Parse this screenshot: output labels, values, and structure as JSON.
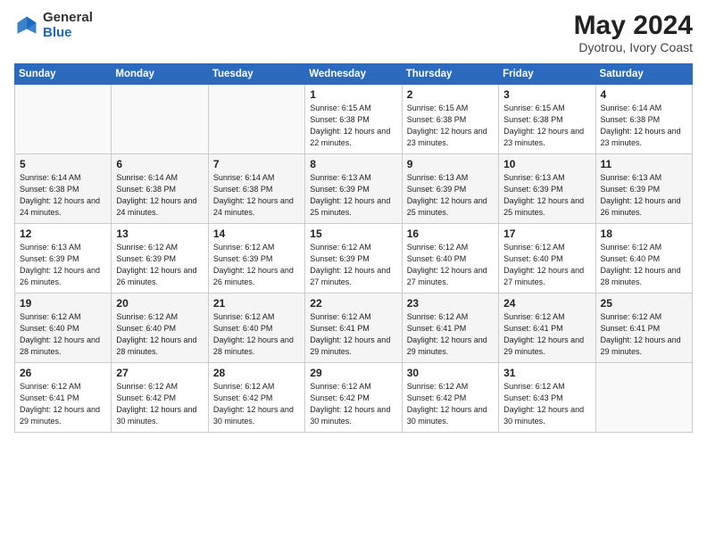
{
  "header": {
    "logo_general": "General",
    "logo_blue": "Blue",
    "month_title": "May 2024",
    "subtitle": "Dyotrou, Ivory Coast"
  },
  "weekdays": [
    "Sunday",
    "Monday",
    "Tuesday",
    "Wednesday",
    "Thursday",
    "Friday",
    "Saturday"
  ],
  "weeks": [
    [
      {
        "day": "",
        "sunrise": "",
        "sunset": "",
        "daylight": ""
      },
      {
        "day": "",
        "sunrise": "",
        "sunset": "",
        "daylight": ""
      },
      {
        "day": "",
        "sunrise": "",
        "sunset": "",
        "daylight": ""
      },
      {
        "day": "1",
        "sunrise": "Sunrise: 6:15 AM",
        "sunset": "Sunset: 6:38 PM",
        "daylight": "Daylight: 12 hours and 22 minutes."
      },
      {
        "day": "2",
        "sunrise": "Sunrise: 6:15 AM",
        "sunset": "Sunset: 6:38 PM",
        "daylight": "Daylight: 12 hours and 23 minutes."
      },
      {
        "day": "3",
        "sunrise": "Sunrise: 6:15 AM",
        "sunset": "Sunset: 6:38 PM",
        "daylight": "Daylight: 12 hours and 23 minutes."
      },
      {
        "day": "4",
        "sunrise": "Sunrise: 6:14 AM",
        "sunset": "Sunset: 6:38 PM",
        "daylight": "Daylight: 12 hours and 23 minutes."
      }
    ],
    [
      {
        "day": "5",
        "sunrise": "Sunrise: 6:14 AM",
        "sunset": "Sunset: 6:38 PM",
        "daylight": "Daylight: 12 hours and 24 minutes."
      },
      {
        "day": "6",
        "sunrise": "Sunrise: 6:14 AM",
        "sunset": "Sunset: 6:38 PM",
        "daylight": "Daylight: 12 hours and 24 minutes."
      },
      {
        "day": "7",
        "sunrise": "Sunrise: 6:14 AM",
        "sunset": "Sunset: 6:38 PM",
        "daylight": "Daylight: 12 hours and 24 minutes."
      },
      {
        "day": "8",
        "sunrise": "Sunrise: 6:13 AM",
        "sunset": "Sunset: 6:39 PM",
        "daylight": "Daylight: 12 hours and 25 minutes."
      },
      {
        "day": "9",
        "sunrise": "Sunrise: 6:13 AM",
        "sunset": "Sunset: 6:39 PM",
        "daylight": "Daylight: 12 hours and 25 minutes."
      },
      {
        "day": "10",
        "sunrise": "Sunrise: 6:13 AM",
        "sunset": "Sunset: 6:39 PM",
        "daylight": "Daylight: 12 hours and 25 minutes."
      },
      {
        "day": "11",
        "sunrise": "Sunrise: 6:13 AM",
        "sunset": "Sunset: 6:39 PM",
        "daylight": "Daylight: 12 hours and 26 minutes."
      }
    ],
    [
      {
        "day": "12",
        "sunrise": "Sunrise: 6:13 AM",
        "sunset": "Sunset: 6:39 PM",
        "daylight": "Daylight: 12 hours and 26 minutes."
      },
      {
        "day": "13",
        "sunrise": "Sunrise: 6:12 AM",
        "sunset": "Sunset: 6:39 PM",
        "daylight": "Daylight: 12 hours and 26 minutes."
      },
      {
        "day": "14",
        "sunrise": "Sunrise: 6:12 AM",
        "sunset": "Sunset: 6:39 PM",
        "daylight": "Daylight: 12 hours and 26 minutes."
      },
      {
        "day": "15",
        "sunrise": "Sunrise: 6:12 AM",
        "sunset": "Sunset: 6:39 PM",
        "daylight": "Daylight: 12 hours and 27 minutes."
      },
      {
        "day": "16",
        "sunrise": "Sunrise: 6:12 AM",
        "sunset": "Sunset: 6:40 PM",
        "daylight": "Daylight: 12 hours and 27 minutes."
      },
      {
        "day": "17",
        "sunrise": "Sunrise: 6:12 AM",
        "sunset": "Sunset: 6:40 PM",
        "daylight": "Daylight: 12 hours and 27 minutes."
      },
      {
        "day": "18",
        "sunrise": "Sunrise: 6:12 AM",
        "sunset": "Sunset: 6:40 PM",
        "daylight": "Daylight: 12 hours and 28 minutes."
      }
    ],
    [
      {
        "day": "19",
        "sunrise": "Sunrise: 6:12 AM",
        "sunset": "Sunset: 6:40 PM",
        "daylight": "Daylight: 12 hours and 28 minutes."
      },
      {
        "day": "20",
        "sunrise": "Sunrise: 6:12 AM",
        "sunset": "Sunset: 6:40 PM",
        "daylight": "Daylight: 12 hours and 28 minutes."
      },
      {
        "day": "21",
        "sunrise": "Sunrise: 6:12 AM",
        "sunset": "Sunset: 6:40 PM",
        "daylight": "Daylight: 12 hours and 28 minutes."
      },
      {
        "day": "22",
        "sunrise": "Sunrise: 6:12 AM",
        "sunset": "Sunset: 6:41 PM",
        "daylight": "Daylight: 12 hours and 29 minutes."
      },
      {
        "day": "23",
        "sunrise": "Sunrise: 6:12 AM",
        "sunset": "Sunset: 6:41 PM",
        "daylight": "Daylight: 12 hours and 29 minutes."
      },
      {
        "day": "24",
        "sunrise": "Sunrise: 6:12 AM",
        "sunset": "Sunset: 6:41 PM",
        "daylight": "Daylight: 12 hours and 29 minutes."
      },
      {
        "day": "25",
        "sunrise": "Sunrise: 6:12 AM",
        "sunset": "Sunset: 6:41 PM",
        "daylight": "Daylight: 12 hours and 29 minutes."
      }
    ],
    [
      {
        "day": "26",
        "sunrise": "Sunrise: 6:12 AM",
        "sunset": "Sunset: 6:41 PM",
        "daylight": "Daylight: 12 hours and 29 minutes."
      },
      {
        "day": "27",
        "sunrise": "Sunrise: 6:12 AM",
        "sunset": "Sunset: 6:42 PM",
        "daylight": "Daylight: 12 hours and 30 minutes."
      },
      {
        "day": "28",
        "sunrise": "Sunrise: 6:12 AM",
        "sunset": "Sunset: 6:42 PM",
        "daylight": "Daylight: 12 hours and 30 minutes."
      },
      {
        "day": "29",
        "sunrise": "Sunrise: 6:12 AM",
        "sunset": "Sunset: 6:42 PM",
        "daylight": "Daylight: 12 hours and 30 minutes."
      },
      {
        "day": "30",
        "sunrise": "Sunrise: 6:12 AM",
        "sunset": "Sunset: 6:42 PM",
        "daylight": "Daylight: 12 hours and 30 minutes."
      },
      {
        "day": "31",
        "sunrise": "Sunrise: 6:12 AM",
        "sunset": "Sunset: 6:43 PM",
        "daylight": "Daylight: 12 hours and 30 minutes."
      },
      {
        "day": "",
        "sunrise": "",
        "sunset": "",
        "daylight": ""
      }
    ]
  ]
}
